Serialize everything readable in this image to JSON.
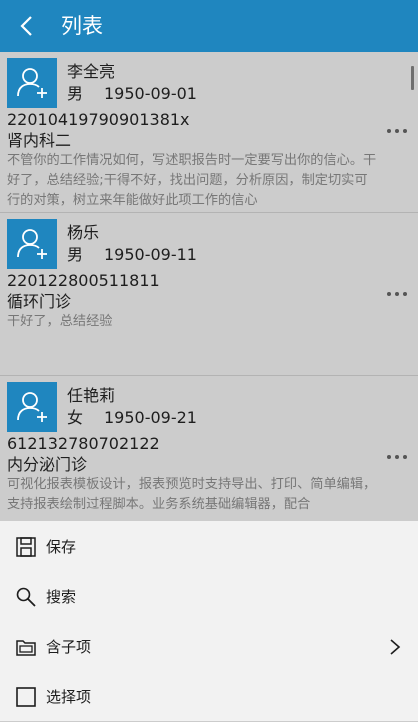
{
  "header": {
    "title": "列表"
  },
  "records": [
    {
      "name": "李全亮",
      "gender": "男",
      "birth_date": "1950-09-01",
      "id_number": "22010419790901381x",
      "department": "肾内科二",
      "notes": "不管你的工作情况如何，写述职报告时一定要写出你的信心。干好了，总结经验;干得不好，找出问题，分析原因，制定切实可行的对策，树立来年能做好此项工作的信心"
    },
    {
      "name": "杨乐",
      "gender": "男",
      "birth_date": "1950-09-11",
      "id_number": "220122800511811",
      "department": "循环门诊",
      "notes": "干好了，总结经验"
    },
    {
      "name": "任艳莉",
      "gender": "女",
      "birth_date": "1950-09-21",
      "id_number": "612132780702122",
      "department": "内分泌门诊",
      "notes": "可视化报表模板设计，报表预览时支持导出、打印、简单编辑，支持报表绘制过程脚本。业务系统基础编辑器，配合"
    }
  ],
  "menu": {
    "items": [
      {
        "label": "保存",
        "icon": "save-icon"
      },
      {
        "label": "搜索",
        "icon": "search-icon"
      },
      {
        "label": "含子项",
        "icon": "folder-icon",
        "has_submenu": true
      },
      {
        "label": "选择项",
        "icon": "checkbox-icon"
      }
    ]
  },
  "colors": {
    "header": "#1f86bf",
    "list_bg": "#cccccc",
    "menu_bg": "#f2f2f2",
    "secondary_text": "#777777"
  }
}
